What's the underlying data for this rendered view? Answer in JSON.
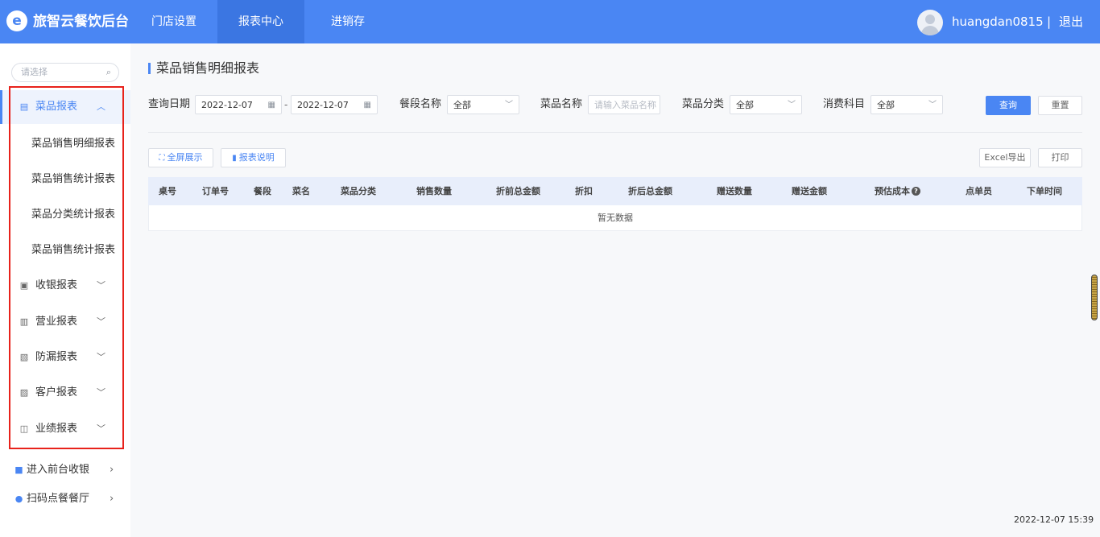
{
  "app": {
    "title": "旅智云餐饮后台",
    "logo_glyph": "e"
  },
  "nav": {
    "tabs": [
      {
        "label": "门店设置"
      },
      {
        "label": "报表中心"
      },
      {
        "label": "进销存"
      }
    ]
  },
  "user": {
    "name": "huangdan0815",
    "separator": "|",
    "logout": "退出"
  },
  "sidebar": {
    "search_placeholder": "请选择",
    "groups": [
      {
        "label": "菜品报表",
        "icon": "dish-report-icon",
        "expanded": true,
        "children": [
          "菜品销售明细报表",
          "菜品销售统计报表",
          "菜品分类统计报表",
          "菜品销售统计报表"
        ]
      },
      {
        "label": "收银报表",
        "icon": "cashier-report-icon"
      },
      {
        "label": "营业报表",
        "icon": "business-report-icon"
      },
      {
        "label": "防漏报表",
        "icon": "leak-report-icon"
      },
      {
        "label": "客户报表",
        "icon": "customer-report-icon"
      },
      {
        "label": "业绩报表",
        "icon": "performance-report-icon"
      }
    ],
    "links": [
      {
        "label": "进入前台收银",
        "icon": "cashier-icon"
      },
      {
        "label": "扫码点餐餐厅",
        "icon": "location-icon"
      }
    ]
  },
  "page": {
    "title": "菜品销售明细报表"
  },
  "filters": {
    "date_label": "查询日期",
    "date_start": "2022-12-07",
    "date_sep": "-",
    "date_end": "2022-12-07",
    "meal_label": "餐段名称",
    "meal_value": "全部",
    "dish_label": "菜品名称",
    "dish_placeholder": "请输入菜品名称",
    "category_label": "菜品分类",
    "category_value": "全部",
    "subject_label": "消费科目",
    "subject_value": "全部",
    "query_btn": "查询",
    "reset_btn": "重置"
  },
  "toolbar": {
    "fullscreen": "全屏展示",
    "explain": "报表说明",
    "excel": "Excel导出",
    "print": "打印"
  },
  "table": {
    "columns": [
      "桌号",
      "订单号",
      "餐段",
      "菜名",
      "菜品分类",
      "销售数量",
      "折前总金额",
      "折扣",
      "折后总金额",
      "赠送数量",
      "赠送金额",
      "预估成本",
      "点单员",
      "下单时间"
    ],
    "empty_text": "暂无数据"
  },
  "footer": {
    "clock": "2022-12-07 15:39"
  },
  "colors": {
    "primary": "#4a86f3",
    "highlight_border": "#e8221b"
  }
}
